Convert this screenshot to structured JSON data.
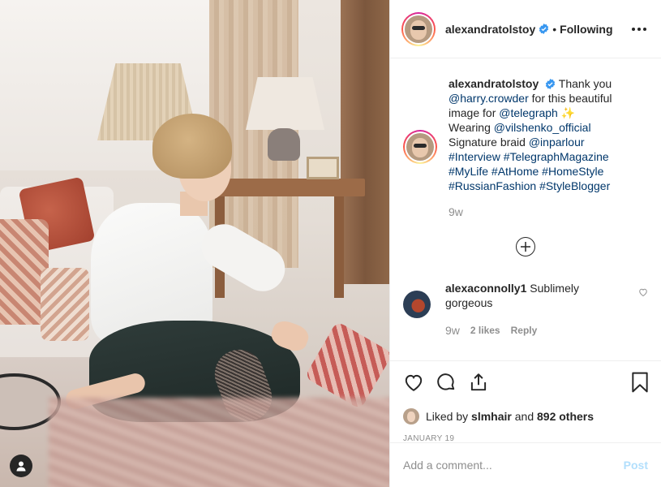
{
  "post_image": {
    "alt": ""
  },
  "header": {
    "username": "alexandratolstoy",
    "separator": "•",
    "follow_status": "Following"
  },
  "caption": {
    "username": "alexandratolstoy",
    "segments": [
      {
        "text": " Thank you ",
        "type": "text"
      },
      {
        "text": "@harry.crowder",
        "type": "link"
      },
      {
        "text": " for this beautiful image for ",
        "type": "text"
      },
      {
        "text": "@telegraph",
        "type": "link"
      },
      {
        "text": " ✨",
        "type": "text"
      },
      {
        "text": "Wearing ",
        "type": "text"
      },
      {
        "text": "@vilshenko_official",
        "type": "link"
      },
      {
        "text": "Signature braid ",
        "type": "text"
      },
      {
        "text": "@inparlour",
        "type": "link"
      },
      {
        "text": "#Interview",
        "type": "link"
      },
      {
        "text": "#TelegraphMagazine",
        "type": "link"
      },
      {
        "text": "#MyLife",
        "type": "link"
      },
      {
        "text": "#AtHome",
        "type": "link"
      },
      {
        "text": "#HomeStyle",
        "type": "link"
      },
      {
        "text": "#RussianFashion",
        "type": "link"
      },
      {
        "text": "#StyleBlogger",
        "type": "link"
      }
    ],
    "time": "9w"
  },
  "comment": {
    "username": "alexaconnolly1",
    "text": "Sublimely gorgeous",
    "time": "9w",
    "likes": "2 likes",
    "reply": "Reply"
  },
  "next_comment_partial": "· · · · · · · ·",
  "likes": {
    "prefix": "Liked by ",
    "user": "slmhair",
    "middle": " and ",
    "count": "892 others"
  },
  "date": "JANUARY 19",
  "add_comment": {
    "placeholder": "Add a comment...",
    "post_label": "Post"
  },
  "colors": {
    "link": "#00376b",
    "verified": "#3897f0",
    "secondary_text": "#8e8e8e",
    "post_disabled": "#b2dffc"
  },
  "icons": [
    "more-options-icon",
    "verified-badge-icon",
    "load-more-icon",
    "heart-icon",
    "comment-icon",
    "share-icon",
    "bookmark-icon",
    "user-tag-icon"
  ]
}
